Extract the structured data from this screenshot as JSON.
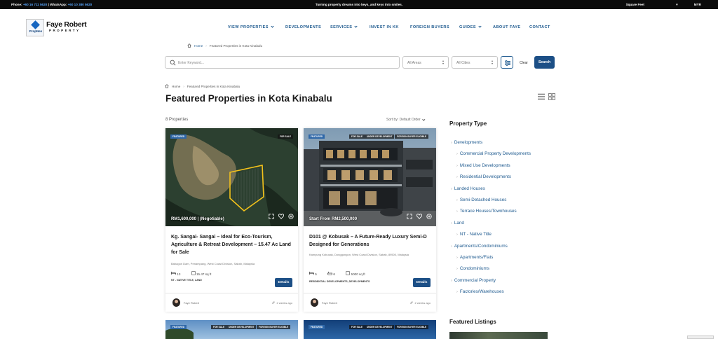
{
  "topbar": {
    "phone_label": "Phone:",
    "phone": "+60 16 711 5620",
    "whatsapp_label": "WhatsApp:",
    "whatsapp": "+60 10 380 5620",
    "tagline": "Turning property dreams into keys, and keys into smiles.",
    "unit": "Square Feet",
    "currency": "MYR"
  },
  "logo": {
    "mark_text": "PropNex",
    "name": "Faye Robert",
    "sub": "PROPERTY"
  },
  "nav": [
    {
      "label": "VIEW PROPERTIES",
      "dropdown": true
    },
    {
      "label": "DEVELOPMENTS",
      "dropdown": false
    },
    {
      "label": "SERVICES",
      "dropdown": true
    },
    {
      "label": "INVEST IN KK",
      "dropdown": false
    },
    {
      "label": "FOREIGN BUYERS",
      "dropdown": false
    },
    {
      "label": "GUIDES",
      "dropdown": true
    },
    {
      "label": "ABOUT FAYE",
      "dropdown": false
    },
    {
      "label": "CONTACT",
      "dropdown": false
    }
  ],
  "breadcrumb": {
    "home": "Home",
    "current": "Featured Properties in Kota Kinabalu"
  },
  "search": {
    "placeholder": "Enter Keyword...",
    "areas": "All Areas",
    "cities": "All Cities",
    "clear": "Clear",
    "button": "Search"
  },
  "page": {
    "title": "Featured Properties in Kota Kinabalu",
    "count": "8 Properties",
    "sort_label": "Sort by: Default Order"
  },
  "listings": [
    {
      "badges": [
        "FEATURED",
        "FOR SALE"
      ],
      "price": "RM1,600,000 | (Negotiable)",
      "title": "Kg. Sangai- Sangai – Ideal for Eco-Tourism, Agriculture & Retreat Development – 15.47 Ac Land for Sale",
      "address": "Babagon Dam, Penampang, West Coast Division, Sabah, Malaysia",
      "spec1": "13",
      "spec2": "15.47 sq ft",
      "category": "NT - NATIVE TITLE, LAND",
      "details": "Details",
      "agent": "Faye Robert",
      "age": "2 weeks ago"
    },
    {
      "badges": [
        "FEATURED",
        "FOR SALE",
        "UNDER DEVELOPMENT",
        "FOREIGN BUYER ELIGIBLE"
      ],
      "price": "Start From RM2,500,000",
      "title": "D101 @ Kobusak – A Future-Ready Luxury Semi-D Designed for Generations",
      "address": "Kampung Kobusak, Donggongon, West Coast Division, Sabah, 89500, Malaysia",
      "spec1": "5",
      "spec2": "6",
      "spec3": "5000 sq ft",
      "category": "RESIDENTIAL DEVELOPMENTS, DEVELOPMENTS",
      "details": "Details",
      "agent": "Faye Robert",
      "age": "2 weeks ago"
    }
  ],
  "listings_row2": [
    {
      "badges": [
        "FEATURED",
        "FOR SALE",
        "UNDER DEVELOPMENT",
        "FOREIGN BUYER ELIGIBLE"
      ]
    },
    {
      "badges": [
        "FEATURED",
        "FOR SALE",
        "UNDER DEVELOPMENT",
        "FOREIGN BUYER ELIGIBLE"
      ]
    }
  ],
  "sidebar": {
    "heading": "Property Type",
    "items": [
      {
        "label": "Developments",
        "level": 0
      },
      {
        "label": "Commercial Property Developments",
        "level": 1
      },
      {
        "label": "Mixed Use Developments",
        "level": 1
      },
      {
        "label": "Residential Developments",
        "level": 1
      },
      {
        "label": "Landed Houses",
        "level": 0
      },
      {
        "label": "Semi-Detached Houses",
        "level": 1
      },
      {
        "label": "Terrace Houses/Townhouses",
        "level": 1
      },
      {
        "label": "Land",
        "level": 0
      },
      {
        "label": "NT - Native Title",
        "level": 1
      },
      {
        "label": "Apartments/Condominiums",
        "level": 0
      },
      {
        "label": "Apartments/Flats",
        "level": 1
      },
      {
        "label": "Condominiums",
        "level": 1
      },
      {
        "label": "Commercial Property",
        "level": 0
      },
      {
        "label": "Factories/Warehouses",
        "level": 1
      }
    ],
    "featured_heading": "Featured Listings"
  },
  "colors": {
    "accent": "#1c4f86",
    "link": "#1e5a8f",
    "topbar": "#0b0b0b"
  }
}
